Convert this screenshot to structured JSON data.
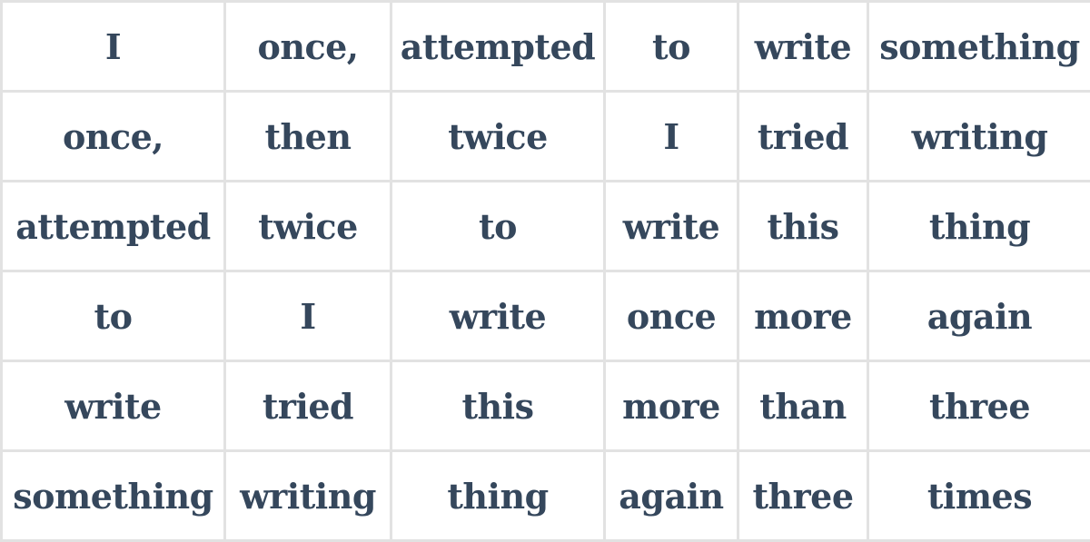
{
  "grid": {
    "rows": [
      [
        "I",
        "once,",
        "attempted",
        "to",
        "write",
        "something"
      ],
      [
        "once,",
        "then",
        "twice",
        "I",
        "tried",
        "writing"
      ],
      [
        "attempted",
        "twice",
        "to",
        "write",
        "this",
        "thing"
      ],
      [
        "to",
        "I",
        "write",
        "once",
        "more",
        "again"
      ],
      [
        "write",
        "tried",
        "this",
        "more",
        "than",
        "three"
      ],
      [
        "something",
        "writing",
        "thing",
        "again",
        "three",
        "times"
      ]
    ]
  }
}
